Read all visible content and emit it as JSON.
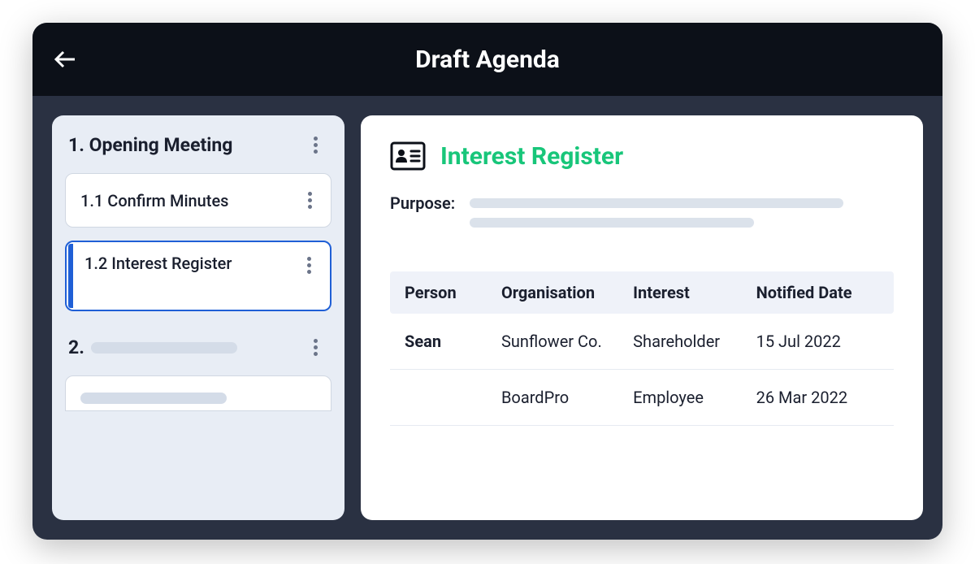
{
  "header": {
    "title": "Draft Agenda"
  },
  "sidebar": {
    "section1": {
      "title": "1. Opening Meeting",
      "items": [
        {
          "label": "1.1 Confirm Minutes"
        },
        {
          "label": "1.2 Interest Register"
        }
      ]
    },
    "section2": {
      "title": "2."
    }
  },
  "panel": {
    "title": "Interest Register",
    "purpose_label": "Purpose:",
    "table": {
      "headers": {
        "person": "Person",
        "organisation": "Organisation",
        "interest": "Interest",
        "notified_date": "Notified Date"
      },
      "rows": [
        {
          "person": "Sean",
          "organisation": "Sunflower Co.",
          "interest": "Shareholder",
          "notified_date": "15 Jul 2022"
        },
        {
          "person": "",
          "organisation": "BoardPro",
          "interest": "Employee",
          "notified_date": "26 Mar 2022"
        }
      ]
    }
  },
  "colors": {
    "accent": "#18c67a",
    "selected": "#1f5fd6"
  }
}
